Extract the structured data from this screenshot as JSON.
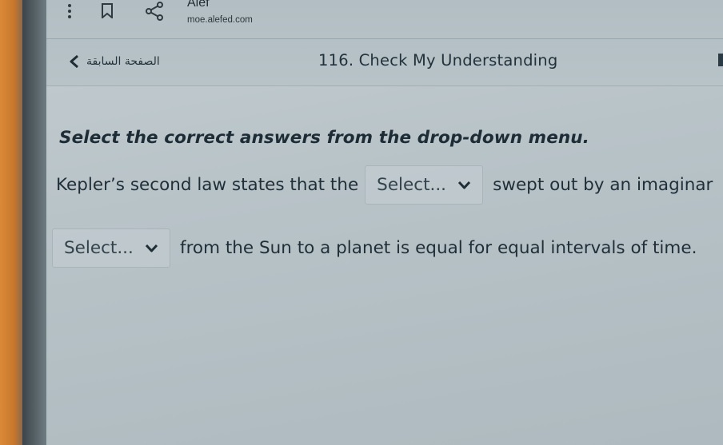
{
  "browser": {
    "site_title": "Alef",
    "site_url": "moe.alefed.com"
  },
  "nav": {
    "back_label": "الصفحة السابقة",
    "lesson_title": "116. Check My Understanding"
  },
  "question": {
    "instruction": "Select the correct answers from the drop-down menu.",
    "line1_before": "Kepler’s second law states that the",
    "line1_after": "swept out by an imaginar",
    "line2_after": "from the Sun to a planet is equal for equal intervals of time."
  },
  "dropdowns": [
    {
      "selected": "Select..."
    },
    {
      "selected": "Select..."
    }
  ],
  "icons": {
    "menu": "kebab-menu-icon",
    "bookmark": "bookmark-icon",
    "share": "share-icon",
    "back": "chevron-left-icon",
    "dropdown": "chevron-down-icon"
  },
  "colors": {
    "screen_bg": "#bcc6cb",
    "text": "#1f2e37",
    "bezel": "#d98a38"
  }
}
